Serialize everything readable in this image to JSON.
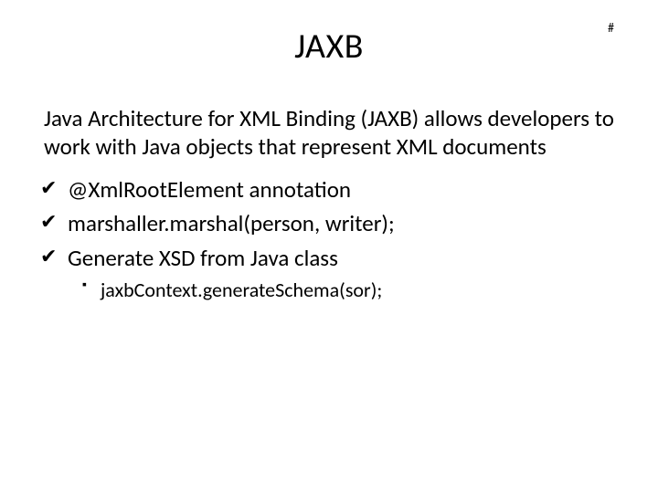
{
  "page_marker": "#",
  "title": "JAXB",
  "intro": "Java Architecture for XML Binding (JAXB) allows developers to work with Java objects that represent XML documents",
  "bullets": [
    "@XmlRootElement annotation",
    "marshaller.marshal(person, writer);",
    "Generate XSD from Java class"
  ],
  "sub_bullets": [
    "jaxbContext.generateSchema(sor);"
  ]
}
